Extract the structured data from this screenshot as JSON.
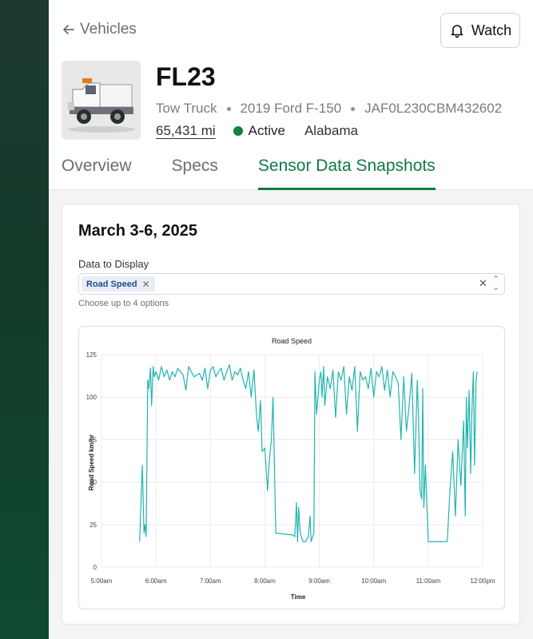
{
  "nav": {
    "back_label": "Vehicles",
    "watch_label": "Watch"
  },
  "vehicle": {
    "name": "FL23",
    "type": "Tow Truck",
    "model": "2019 Ford F-150",
    "vin": "JAF0L230CBM432602",
    "mileage": "65,431 mi",
    "status": "Active",
    "status_color": "#15803d",
    "location": "Alabama"
  },
  "tabs": [
    {
      "label": "Overview",
      "active": false
    },
    {
      "label": "Specs",
      "active": false
    },
    {
      "label": "Sensor Data Snapshots",
      "active": true
    }
  ],
  "colors": {
    "accent": "#0f7a45",
    "line": "#20b5ad",
    "chip_bg": "#e8eef7",
    "chip_text": "#1f4d8f"
  },
  "snapshot": {
    "date_range": "March 3-6, 2025",
    "field_label": "Data to Display",
    "selected": [
      "Road Speed"
    ],
    "help": "Choose up to 4 options"
  },
  "chart_data": {
    "type": "line",
    "title": "Road Speed",
    "xlabel": "Time",
    "ylabel": "Road Speed km/hr",
    "ylim": [
      0,
      125
    ],
    "xlim": [
      5.0,
      12.0
    ],
    "y_ticks": [
      0,
      25,
      50,
      75,
      100,
      125
    ],
    "x_ticks": [
      {
        "value": 5.0,
        "label": "5:00am"
      },
      {
        "value": 6.0,
        "label": "6:00am"
      },
      {
        "value": 7.0,
        "label": "7:00am"
      },
      {
        "value": 8.0,
        "label": "8:00am"
      },
      {
        "value": 9.0,
        "label": "9:00am"
      },
      {
        "value": 10.0,
        "label": "10:00am"
      },
      {
        "value": 11.0,
        "label": "11:00am"
      },
      {
        "value": 12.0,
        "label": "12:00pm"
      }
    ],
    "grid": true,
    "series": [
      {
        "name": "Road Speed",
        "x": [
          5.7,
          5.75,
          5.78,
          5.8,
          5.82,
          5.85,
          5.87,
          5.9,
          5.92,
          5.95,
          5.97,
          6.0,
          6.05,
          6.1,
          6.15,
          6.2,
          6.25,
          6.3,
          6.35,
          6.4,
          6.5,
          6.55,
          6.6,
          6.7,
          6.8,
          6.85,
          6.9,
          6.95,
          7.0,
          7.05,
          7.1,
          7.15,
          7.2,
          7.25,
          7.3,
          7.35,
          7.4,
          7.45,
          7.5,
          7.55,
          7.6,
          7.65,
          7.7,
          7.75,
          7.8,
          7.85,
          7.88,
          7.92,
          7.95,
          8.0,
          8.05,
          8.08,
          8.12,
          8.15,
          8.2,
          8.5,
          8.55,
          8.58,
          8.6,
          8.62,
          8.65,
          8.7,
          8.75,
          8.8,
          8.83,
          8.85,
          8.9,
          8.92,
          8.95,
          9.0,
          9.03,
          9.05,
          9.08,
          9.1,
          9.15,
          9.2,
          9.25,
          9.3,
          9.35,
          9.4,
          9.45,
          9.5,
          9.55,
          9.6,
          9.65,
          9.7,
          9.75,
          9.8,
          9.85,
          9.9,
          9.95,
          10.0,
          10.05,
          10.1,
          10.15,
          10.2,
          10.25,
          10.3,
          10.35,
          10.4,
          10.45,
          10.5,
          10.55,
          10.6,
          10.65,
          10.7,
          10.75,
          10.8,
          10.82,
          10.85,
          10.88,
          10.9,
          10.92,
          10.95,
          11.0,
          11.05,
          11.1,
          11.15,
          11.2,
          11.25,
          11.3,
          11.35,
          11.4,
          11.45,
          11.5,
          11.55,
          11.6,
          11.65,
          11.68,
          11.7,
          11.72,
          11.75,
          11.78,
          11.8,
          11.83,
          11.85,
          11.88,
          11.9
        ],
        "values": [
          15,
          60,
          20,
          25,
          18,
          110,
          105,
          117,
          95,
          118,
          112,
          115,
          110,
          118,
          112,
          116,
          110,
          115,
          112,
          117,
          113,
          104,
          118,
          112,
          114,
          110,
          117,
          105,
          116,
          118,
          112,
          115,
          117,
          110,
          115,
          119,
          110,
          115,
          113,
          117,
          110,
          105,
          115,
          100,
          116,
          88,
          80,
          98,
          68,
          70,
          45,
          62,
          75,
          100,
          20,
          19,
          18,
          38,
          15,
          35,
          20,
          15,
          15,
          18,
          30,
          15,
          20,
          115,
          90,
          110,
          115,
          100,
          118,
          95,
          112,
          105,
          116,
          88,
          115,
          110,
          118,
          90,
          112,
          104,
          118,
          80,
          115,
          110,
          112,
          105,
          117,
          100,
          115,
          112,
          118,
          104,
          116,
          100,
          115,
          112,
          108,
          75,
          112,
          80,
          95,
          114,
          55,
          110,
          90,
          45,
          40,
          105,
          35,
          60,
          15,
          15,
          15,
          15,
          15,
          15,
          15,
          15,
          45,
          68,
          30,
          75,
          48,
          86,
          30,
          100,
          70,
          104,
          55,
          90,
          115,
          60,
          110,
          115
        ]
      }
    ]
  }
}
